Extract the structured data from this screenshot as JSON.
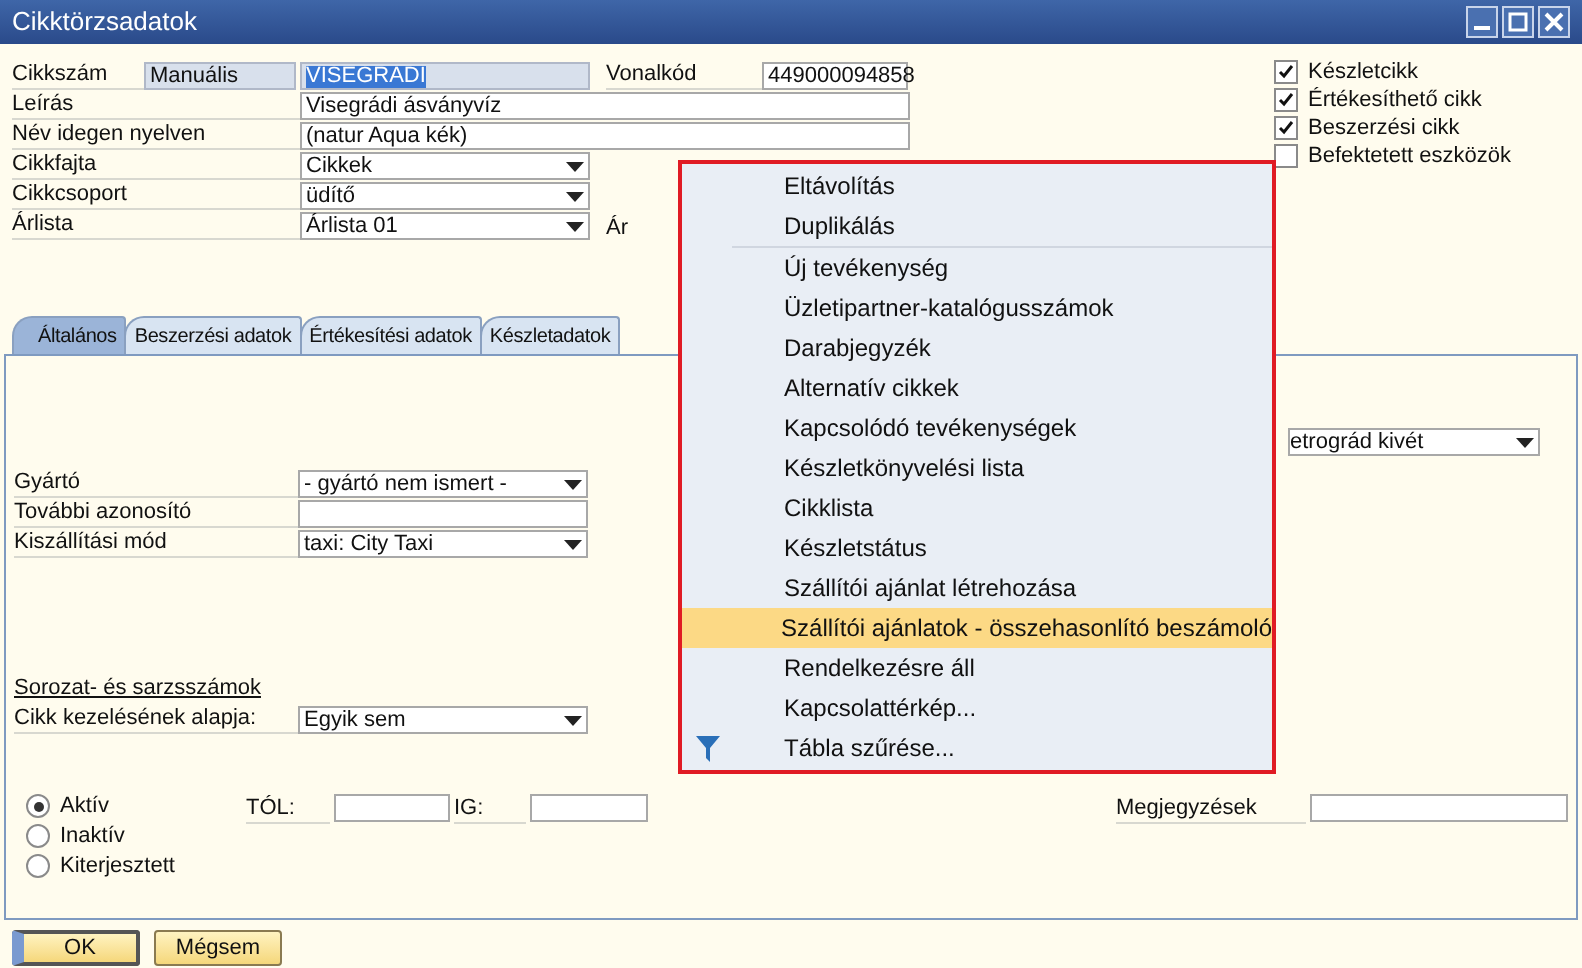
{
  "window": {
    "title": "Cikktörzsadatok"
  },
  "header": {
    "item_no": {
      "label": "Cikkszám",
      "series": "Manuális",
      "value": "VISEGRADI"
    },
    "barcode": {
      "label": "Vonalkód",
      "value": "449000094858"
    },
    "rows": [
      {
        "label": "Leírás",
        "kind": "text",
        "value": "Visegrádi ásványvíz"
      },
      {
        "label": "Név idegen nyelven",
        "kind": "text",
        "value": "(natur Aqua kék)"
      },
      {
        "label": "Cikkfajta",
        "kind": "dropdown",
        "value": "Cikkek"
      },
      {
        "label": "Cikkcsoport",
        "kind": "dropdown",
        "value": "üdítő"
      },
      {
        "label": "Árlista",
        "kind": "dropdown",
        "value": "Árlista 01",
        "extra": "Ár"
      }
    ]
  },
  "checkboxes": [
    {
      "label": "Készletcikk",
      "checked": true
    },
    {
      "label": "Értékesíthető cikk",
      "checked": true
    },
    {
      "label": "Beszerzési cikk",
      "checked": true
    },
    {
      "label": "Befektetett eszközök",
      "checked": false
    }
  ],
  "tabs": [
    {
      "label": "Általános",
      "selected": true
    },
    {
      "label": "Beszerzési adatok",
      "selected": false
    },
    {
      "label": "Értékesítési adatok",
      "selected": false
    },
    {
      "label": "Készletadatok",
      "selected": false
    }
  ],
  "general": {
    "retro_value": "etrográd kivét",
    "rows": [
      {
        "label": "Gyártó",
        "kind": "dropdown",
        "value": "- gyártó nem ismert -"
      },
      {
        "label": "További azonosító",
        "kind": "text"
      },
      {
        "label": "Kiszállítási mód",
        "kind": "dropdown",
        "value": "taxi: City Taxi"
      }
    ],
    "serial_title": "Sorozat- és sarzsszámok",
    "serial_row": {
      "label": "Cikk kezelésének alapja:",
      "value": "Egyik sem"
    },
    "status": [
      {
        "label": "Aktív",
        "selected": true
      },
      {
        "label": "Inaktív",
        "selected": false
      },
      {
        "label": "Kiterjesztett",
        "selected": false
      }
    ],
    "from_label": "TÓL:",
    "to_label": "IG:",
    "remarks_label": "Megjegyzések"
  },
  "buttons": [
    {
      "label": "OK",
      "default": true
    },
    {
      "label": "Mégsem",
      "default": false
    }
  ],
  "context_menu": {
    "groups": [
      [
        {
          "label": "Eltávolítás",
          "kind": "item",
          "selected": false
        },
        {
          "label": "Duplikálás",
          "kind": "item",
          "selected": false
        }
      ],
      [
        {
          "label": "Új tevékenység",
          "kind": "item",
          "selected": false
        },
        {
          "label": "Üzletipartner-katalógusszámok",
          "kind": "item",
          "selected": false
        },
        {
          "label": "Darabjegyzék",
          "kind": "item",
          "selected": false
        },
        {
          "label": "Alternatív cikkek",
          "kind": "item",
          "selected": false
        },
        {
          "label": "Kapcsolódó tevékenységek",
          "kind": "item",
          "selected": false
        },
        {
          "label": "Készletkönyvelési lista",
          "kind": "item",
          "selected": false
        },
        {
          "label": "Cikklista",
          "kind": "item",
          "selected": false
        },
        {
          "label": "Készletstátus",
          "kind": "item",
          "selected": false
        },
        {
          "label": "Szállítói ajánlat létrehozása",
          "kind": "item",
          "selected": false
        },
        {
          "label": "Szállítói ajánlatok - összehasonlító beszámoló",
          "kind": "item",
          "selected": true
        },
        {
          "label": "Rendelkezésre áll",
          "kind": "item",
          "selected": false
        },
        {
          "label": "Kapcsolattérkép...",
          "kind": "item",
          "selected": false
        },
        {
          "label": "Tábla szűrése...",
          "kind": "filter",
          "selected": false
        }
      ]
    ]
  }
}
